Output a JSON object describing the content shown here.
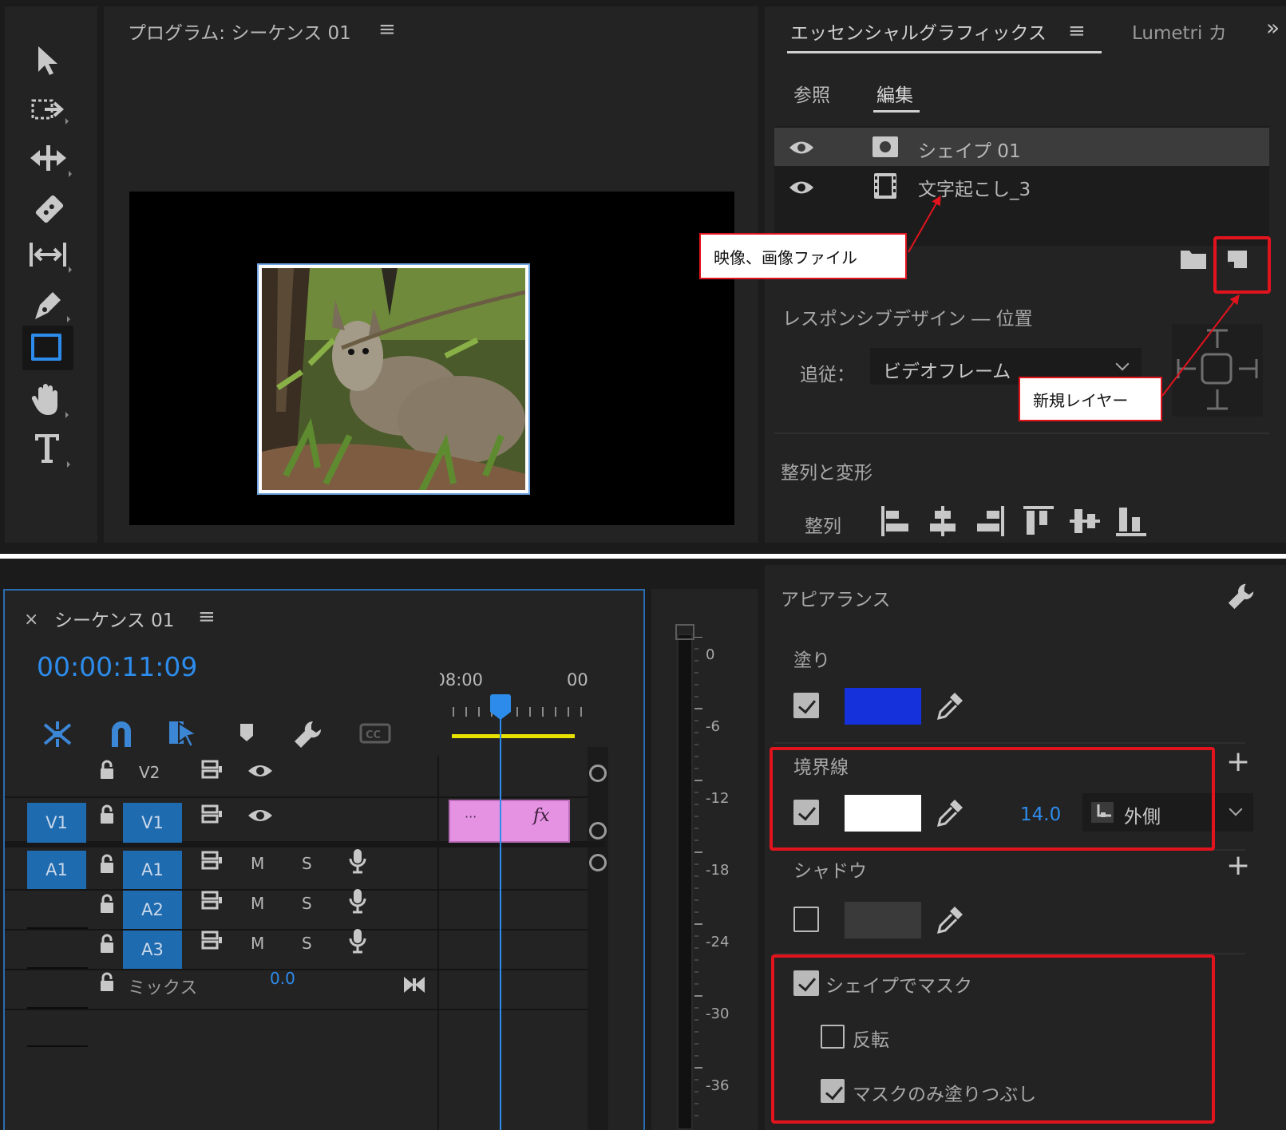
{
  "tools": [
    "selection-tool",
    "track-select-tool",
    "ripple-edit-tool",
    "razor-tool",
    "slip-tool",
    "pen-tool",
    "rectangle-tool",
    "hand-tool",
    "type-tool"
  ],
  "program": {
    "title": "プログラム: シーケンス 01",
    "menu": "≡"
  },
  "essential": {
    "tab_active": "エッセンシャルグラフィックス",
    "tab_menu": "≡",
    "tab_other": "Lumetri カ",
    "overflow": "»",
    "subtab_browse": "参照",
    "subtab_edit": "編集",
    "layers": [
      {
        "name": "シェイプ 01",
        "type": "shape"
      },
      {
        "name": "文字起こし_3",
        "type": "video"
      }
    ],
    "responsive_title": "レスポンシブデザイン ― 位置",
    "follow_label": "追従：",
    "follow_value": "ビデオフレーム",
    "align_section": "整列と変形",
    "align_label": "整列"
  },
  "callouts": {
    "video_file": "映像、画像ファイル",
    "new_layer": "新規レイヤー"
  },
  "sequence": {
    "close": "×",
    "title": "シーケンス 01",
    "menu": "≡",
    "timecode": "00:00:11:09",
    "ruler_left": "08:00",
    "ruler_right": "00",
    "clip_marker": "···",
    "clip_fx": "fx",
    "tracks": {
      "v2": "V2",
      "v1_src": "V1",
      "v1": "V1",
      "a1_src": "A1",
      "a1": "A1",
      "a2": "A2",
      "a3": "A3",
      "mix": "ミックス",
      "mix_value": "0.0",
      "m": "M",
      "s": "S"
    }
  },
  "meter": {
    "labels": [
      "0",
      "-6",
      "-12",
      "-18",
      "-24",
      "-30",
      "-36"
    ]
  },
  "appearance": {
    "title": "アピアランス",
    "fill_label": "塗り",
    "fill_checked": true,
    "fill_color": "#1431dc",
    "stroke_label": "境界線",
    "stroke_checked": true,
    "stroke_color": "#ffffff",
    "stroke_width": "14.0",
    "stroke_position": "外側",
    "shadow_label": "シャドウ",
    "shadow_checked": false,
    "shadow_color": "#3a3a3a",
    "mask_label": "シェイプでマスク",
    "mask_checked": true,
    "invert_label": "反転",
    "invert_checked": false,
    "mask_only_label": "マスクのみ塗りつぶし",
    "mask_only_checked": true
  },
  "colors": {
    "panel_bg": "#232323",
    "accent_blue": "#2d8ceb",
    "track_blue": "#1f6bb0",
    "clip_pink": "#e592e3",
    "highlight_red": "#e1141e",
    "work_area_yellow": "#e8e100"
  }
}
